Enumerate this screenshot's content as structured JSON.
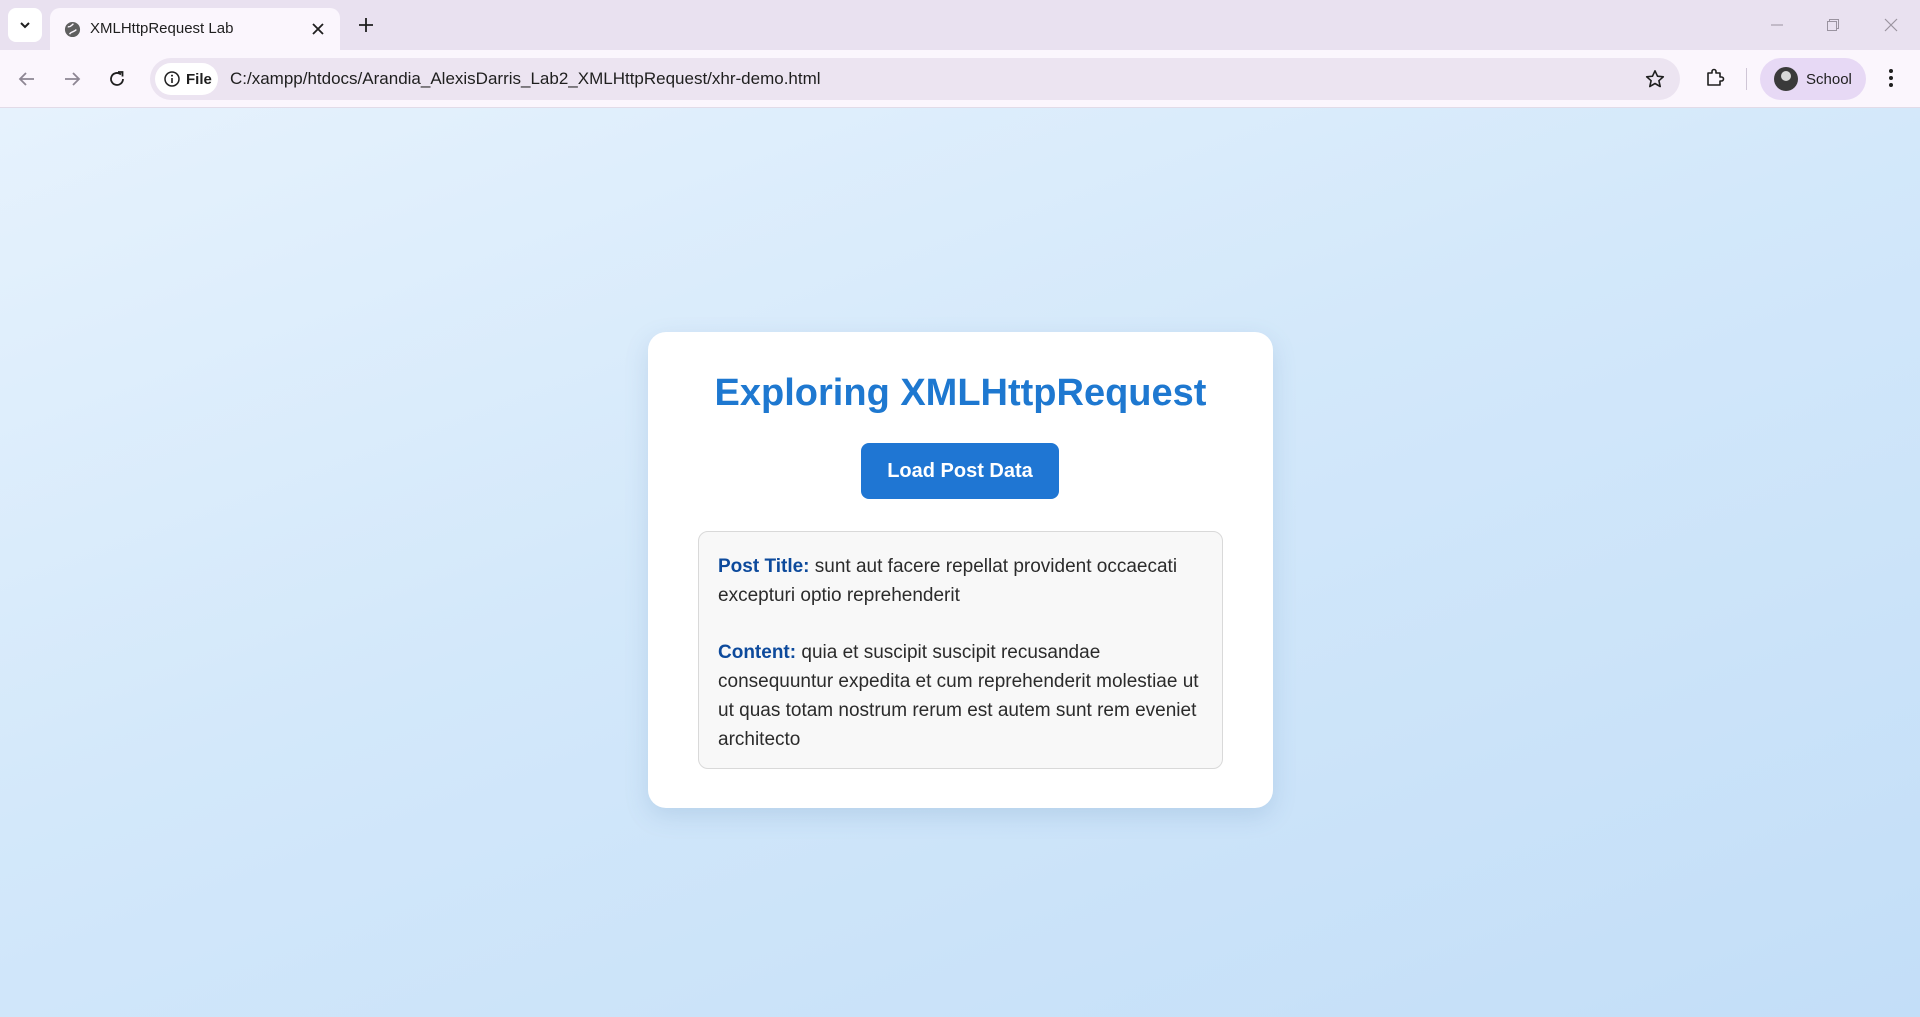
{
  "browser": {
    "tab": {
      "title": "XMLHttpRequest Lab"
    },
    "address": {
      "chip_label": "File",
      "url": "C:/xampp/htdocs/Arandia_AlexisDarris_Lab2_XMLHttpRequest/xhr-demo.html"
    },
    "profile": {
      "name": "School"
    },
    "icons": [
      "chevron-down-icon",
      "globe-icon",
      "close-icon",
      "plus-icon",
      "minimize-icon",
      "restore-icon",
      "back-icon",
      "forward-icon",
      "reload-icon",
      "info-icon",
      "star-icon",
      "extensions-icon",
      "more-vert-icon"
    ]
  },
  "page": {
    "title": "Exploring XMLHttpRequest",
    "load_button": "Load Post Data",
    "result": {
      "title_label": "Post Title:",
      "title_value": " sunt aut facere repellat provident occaecati excepturi optio reprehenderit",
      "content_label": "Content:",
      "content_value": " quia et suscipit suscipit recusandae consequuntur expedita et cum reprehenderit molestiae ut ut quas totam nostrum rerum est autem sunt rem eveniet architecto"
    }
  },
  "colors": {
    "accent": "#1f76d3",
    "heading": "#1e78d0",
    "label": "#0d4a9c",
    "tabstrip": "#e9e1f0",
    "toolbar": "#fbf6fd"
  }
}
